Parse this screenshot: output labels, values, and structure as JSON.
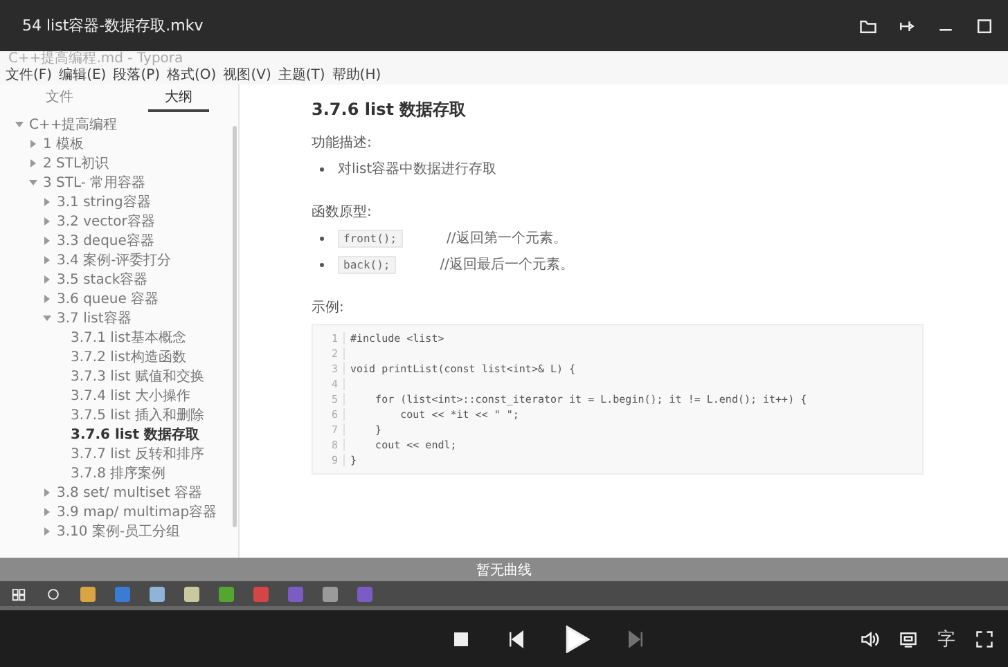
{
  "player": {
    "title": "54 list容器-数据存取.mkv"
  },
  "typora": {
    "title": "C++提高编程.md - Typora",
    "menu": [
      "文件(F)",
      "编辑(E)",
      "段落(P)",
      "格式(O)",
      "视图(V)",
      "主题(T)",
      "帮助(H)"
    ],
    "tabs": [
      {
        "label": "文件",
        "selected": false
      },
      {
        "label": "大纲",
        "selected": true
      }
    ],
    "outline": [
      {
        "label": "C++提高编程",
        "expanded": true,
        "selected": false,
        "children": [
          {
            "label": "1 模板",
            "expanded": false,
            "selected": false
          },
          {
            "label": "2 STL初识",
            "expanded": false,
            "selected": false
          },
          {
            "label": "3 STL- 常用容器",
            "expanded": true,
            "selected": false,
            "children": [
              {
                "label": "3.1 string容器",
                "expanded": false,
                "selected": false
              },
              {
                "label": "3.2 vector容器",
                "expanded": false,
                "selected": false
              },
              {
                "label": "3.3 deque容器",
                "expanded": false,
                "selected": false
              },
              {
                "label": "3.4 案例-评委打分",
                "expanded": false,
                "selected": false
              },
              {
                "label": "3.5 stack容器",
                "expanded": false,
                "selected": false
              },
              {
                "label": "3.6 queue 容器",
                "expanded": false,
                "selected": false
              },
              {
                "label": "3.7 list容器",
                "expanded": true,
                "selected": false,
                "children": [
                  {
                    "label": "3.7.1 list基本概念",
                    "selected": false
                  },
                  {
                    "label": "3.7.2 list构造函数",
                    "selected": false
                  },
                  {
                    "label": "3.7.3 list 赋值和交换",
                    "selected": false
                  },
                  {
                    "label": "3.7.4 list 大小操作",
                    "selected": false
                  },
                  {
                    "label": "3.7.5 list 插入和删除",
                    "selected": false
                  },
                  {
                    "label": "3.7.6 list 数据存取",
                    "selected": true
                  },
                  {
                    "label": "3.7.7 list 反转和排序",
                    "selected": false
                  },
                  {
                    "label": "3.7.8 排序案例",
                    "selected": false
                  }
                ]
              },
              {
                "label": "3.8 set/ multiset 容器",
                "expanded": false,
                "selected": false
              },
              {
                "label": "3.9 map/ multimap容器",
                "expanded": false,
                "selected": false
              },
              {
                "label": "3.10 案例-员工分组",
                "expanded": false,
                "selected": false
              }
            ]
          }
        ]
      }
    ],
    "document": {
      "heading": "3.7.6 list 数据存取",
      "sections": [
        {
          "title": "功能描述:",
          "items": [
            {
              "kind": "text",
              "text": "对list容器中数据进行存取"
            }
          ]
        },
        {
          "title": "函数原型:",
          "items": [
            {
              "kind": "code",
              "code": "front();",
              "comment": "//返回第一个元素。"
            },
            {
              "kind": "code",
              "code": "back();",
              "comment": "//返回最后一个元素。"
            }
          ]
        },
        {
          "title": "示例:"
        }
      ],
      "code": [
        {
          "number": "1",
          "text": "#include <list>"
        },
        {
          "number": "2"
        },
        {
          "number": "3",
          "text": "void printList(const list<int>& L) {"
        },
        {
          "number": "4"
        },
        {
          "number": "5",
          "text": "    for (list<int>::const_iterator it = L.begin(); it != L.end(); it++) {"
        },
        {
          "number": "6",
          "text": "        cout << *it << \" \";"
        },
        {
          "number": "7",
          "text": "    }"
        },
        {
          "number": "8",
          "text": "    cout << endl;"
        },
        {
          "number": "9",
          "text": "}"
        }
      ]
    }
  },
  "overlay": {
    "text": "暂无曲线"
  },
  "controls": {
    "subtitle_label": "字",
    "next_disabled": true
  }
}
